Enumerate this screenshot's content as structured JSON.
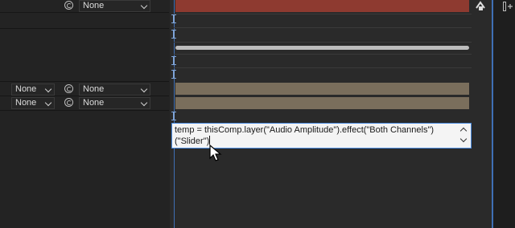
{
  "layers": [
    {
      "parent_mode": "",
      "parent": "None"
    },
    {
      "parent_mode": "None",
      "parent": "None"
    },
    {
      "parent_mode": "None",
      "parent": "None"
    }
  ],
  "expression": {
    "text_before_caret": "temp = thisComp.layer(\"Audio Amplitude\").effect(\"Both Channels\")(\"Slider\")",
    "text_after_caret": ""
  },
  "colors": {
    "red_layer_bar": "#8e3a30",
    "tan_layer_bar": "#7a6e5c",
    "light_bar": "#bdbdbd",
    "editor_border": "#4a8be0",
    "timeline_bg": "#2a2a2a"
  },
  "icons": {
    "pickwhip": "spiral-pickwhip-icon",
    "dropdown": "chevron-down-icon",
    "cursor": "mouse-pointer-icon",
    "panel": "panel-menu-icon"
  }
}
